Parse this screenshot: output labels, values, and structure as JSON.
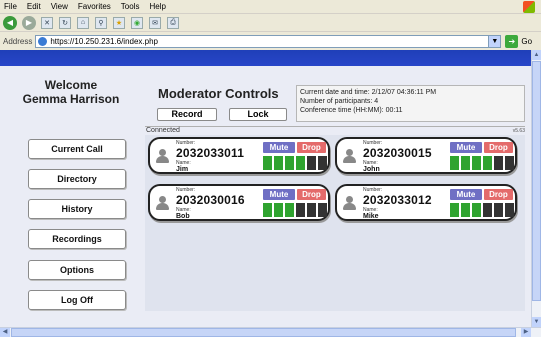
{
  "browser": {
    "menu": [
      "File",
      "Edit",
      "View",
      "Favorites",
      "Tools",
      "Help"
    ],
    "address_label": "Address",
    "url": "https://10.250.231.6/index.php",
    "go_label": "Go"
  },
  "sidebar": {
    "welcome_line1": "Welcome",
    "welcome_line2": "Gemma Harrison",
    "nav": [
      "Current Call",
      "Directory",
      "History",
      "Recordings",
      "Options",
      "Log Off"
    ]
  },
  "main": {
    "title": "Moderator Controls",
    "record_label": "Record",
    "lock_label": "Lock",
    "info": {
      "datetime": "Current date and time:  2/12/07 04:36:11 PM",
      "participants": "Number of participants:  4",
      "conference_time": "Conference time (HH:MM):  00:11"
    },
    "connected_label": "Connected",
    "version": "v5.63"
  },
  "participants": [
    {
      "number_label": "Number:",
      "number": "2032033011",
      "name_label": "Name:",
      "name": "Jim",
      "mute": "Mute",
      "drop": "Drop",
      "level": 4
    },
    {
      "number_label": "Number:",
      "number": "2032030015",
      "name_label": "Name:",
      "name": "John",
      "mute": "Mute",
      "drop": "Drop",
      "level": 4
    },
    {
      "number_label": "Number:",
      "number": "2032030016",
      "name_label": "Name:",
      "name": "Bob",
      "mute": "Mute",
      "drop": "Drop",
      "level": 3
    },
    {
      "number_label": "Number:",
      "number": "2032033012",
      "name_label": "Name:",
      "name": "Mike",
      "mute": "Mute",
      "drop": "Drop",
      "level": 3
    }
  ],
  "meter_segments": 6,
  "colors": {
    "mute": "#6f6fc4",
    "drop": "#e46b6b",
    "level_on": "#2fa32f",
    "level_off": "#333333",
    "top_band": "#2846c8"
  }
}
